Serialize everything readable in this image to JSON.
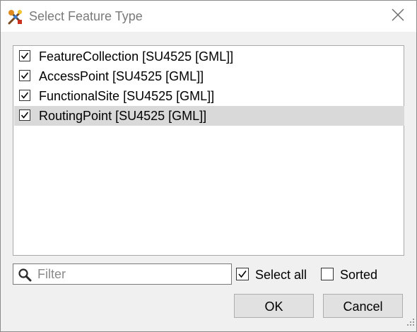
{
  "window": {
    "title": "Select Feature Type",
    "icon": "fme-workbench-icon",
    "close_icon": "close-icon"
  },
  "feature_list": {
    "items": [
      {
        "label": "FeatureCollection [SU4525 [GML]]",
        "checked": true,
        "selected": false
      },
      {
        "label": "AccessPoint [SU4525 [GML]]",
        "checked": true,
        "selected": false
      },
      {
        "label": "FunctionalSite [SU4525 [GML]]",
        "checked": true,
        "selected": false
      },
      {
        "label": "RoutingPoint [SU4525 [GML]]",
        "checked": true,
        "selected": true
      }
    ]
  },
  "filter": {
    "placeholder": "Filter",
    "value": "",
    "icon": "search-icon"
  },
  "options": {
    "select_all": {
      "label": "Select all",
      "checked": true
    },
    "sorted": {
      "label": "Sorted",
      "checked": false
    }
  },
  "buttons": {
    "ok_label": "OK",
    "cancel_label": "Cancel"
  },
  "colors": {
    "selection_row": "#d9d9d9",
    "dialog_bg": "#f0f0f0",
    "button_bg": "#e1e1e1"
  }
}
